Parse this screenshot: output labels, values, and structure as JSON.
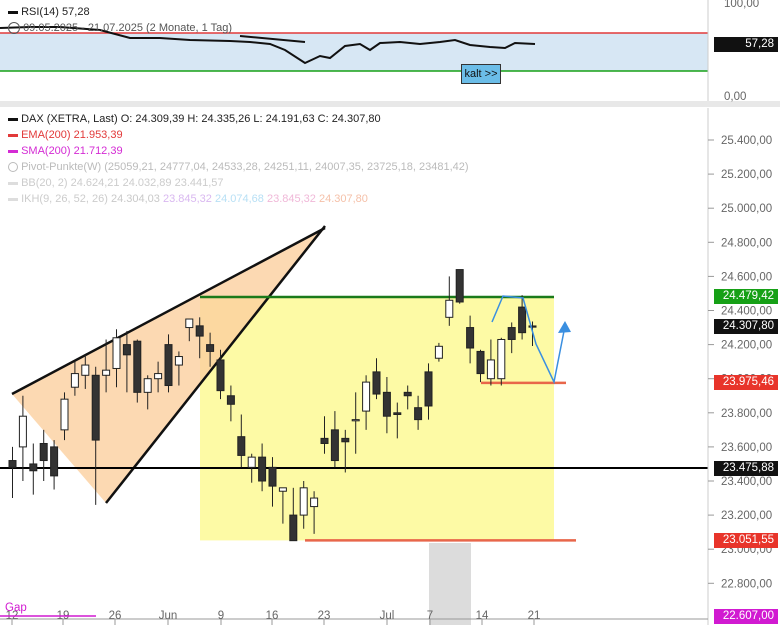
{
  "rsi_panel": {
    "label": "RSI(14)",
    "value_label": "57,28",
    "period": "09.05.2025 - 21.07.2025",
    "span": "(2 Monate, 1 Tag)",
    "y_ticks": [
      "100,00",
      "0,00"
    ],
    "current_tag": "57,28",
    "button_label": "kalt >>"
  },
  "legend": {
    "main": "DAX (XETRA, Last)",
    "ohlc": "O: 24.309,39   H: 24.335,26   L: 24.191,63   C: 24.307,80",
    "ema_label": "EMA(200)",
    "ema_value": "21.953,39",
    "sma_label": "SMA(200)",
    "sma_value": "21.712,39",
    "pivot_label": "Pivot-Punkte(W)",
    "pivot_values": "(25059,21,   24777,04,   24533,28,   24251,11,   24007,35,   23725,18,   23481,42)",
    "bb_label": "BB(20, 2)",
    "bb_values": "24.624,21   24.032,89   23.441,57",
    "ikh_label": "IKH(9, 26, 52, 26)",
    "ikh_values": [
      "24.304,03",
      "23.845,32",
      "24.074,68",
      "23.845,32",
      "24.307,80"
    ]
  },
  "colors": {
    "up": "#ffffff",
    "down": "#333333",
    "wedge": "#fbcf9f",
    "box": "#fdfaa0",
    "resistance": "#1a7a1a",
    "support": "#e8664a",
    "level": "#000000",
    "projection": "#3a8fe0",
    "ema": "#e23a3a",
    "sma": "#d42bd4",
    "tag_green": "#16a016",
    "tag_black": "#111111",
    "tag_red": "#e8342a",
    "tag_magenta": "#d11ad1",
    "rsi_fill": "#d7e7f4"
  },
  "price_axis_labels": [
    "25.400,00",
    "25.200,00",
    "25.000,00",
    "24.800,00",
    "24.600,00",
    "24.400,00",
    "24.200,00",
    "24.000,00",
    "23.800,00",
    "23.600,00",
    "23.400,00",
    "23.200,00",
    "23.000,00",
    "22.800,00"
  ],
  "x_axis_labels": [
    "12",
    "19",
    "26",
    "Jun",
    "9",
    "16",
    "23",
    "Jul",
    "7",
    "14",
    "21"
  ],
  "gap_label": "Gap",
  "price_tags": [
    {
      "value": "24.479,42",
      "price": 24479.42,
      "color": "tag_green"
    },
    {
      "value": "24.307,80",
      "price": 24307.8,
      "color": "tag_black"
    },
    {
      "value": "23.975,46",
      "price": 23975.46,
      "color": "tag_red"
    },
    {
      "value": "23.475,88",
      "price": 23475.88,
      "color": "tag_black"
    },
    {
      "value": "23.051,55",
      "price": 23051.55,
      "color": "tag_red"
    },
    {
      "value": "22.607,00",
      "price": 22607,
      "color": "tag_magenta"
    }
  ],
  "chart_data": {
    "type": "candlestick",
    "title": "DAX (XETRA, Last)",
    "period": "09.05.2025 - 21.07.2025",
    "ylim": [
      22607,
      25450
    ],
    "y_ticks": [
      25400,
      25200,
      25000,
      24800,
      24600,
      24400,
      24200,
      24000,
      23800,
      23600,
      23400,
      23200,
      23000,
      22800
    ],
    "levels": {
      "resistance": 24479.42,
      "support_upper": 23975.46,
      "horizontal": 23475.88,
      "support_lower": 23051.55
    },
    "candles": [
      {
        "o": 23520,
        "h": 23600,
        "l": 23300,
        "c": 23480
      },
      {
        "o": 23600,
        "h": 23900,
        "l": 23400,
        "c": 23780
      },
      {
        "o": 23500,
        "h": 23620,
        "l": 23320,
        "c": 23460
      },
      {
        "o": 23620,
        "h": 23700,
        "l": 23400,
        "c": 23520
      },
      {
        "o": 23600,
        "h": 23640,
        "l": 23350,
        "c": 23430
      },
      {
        "o": 23700,
        "h": 23920,
        "l": 23640,
        "c": 23880
      },
      {
        "o": 23950,
        "h": 24100,
        "l": 23900,
        "c": 24030
      },
      {
        "o": 24020,
        "h": 24140,
        "l": 23940,
        "c": 24080
      },
      {
        "o": 24020,
        "h": 24070,
        "l": 23260,
        "c": 23640
      },
      {
        "o": 24020,
        "h": 24230,
        "l": 23920,
        "c": 24050
      },
      {
        "o": 24060,
        "h": 24290,
        "l": 23950,
        "c": 24240
      },
      {
        "o": 24200,
        "h": 24280,
        "l": 23920,
        "c": 24140
      },
      {
        "o": 24220,
        "h": 24230,
        "l": 23860,
        "c": 23920
      },
      {
        "o": 23920,
        "h": 24020,
        "l": 23820,
        "c": 24000
      },
      {
        "o": 24000,
        "h": 24100,
        "l": 23920,
        "c": 24030
      },
      {
        "o": 24200,
        "h": 24260,
        "l": 23920,
        "c": 23960
      },
      {
        "o": 24080,
        "h": 24160,
        "l": 23960,
        "c": 24130
      },
      {
        "o": 24300,
        "h": 24350,
        "l": 24220,
        "c": 24350
      },
      {
        "o": 24310,
        "h": 24360,
        "l": 24120,
        "c": 24250
      },
      {
        "o": 24200,
        "h": 24270,
        "l": 24070,
        "c": 24160
      },
      {
        "o": 24110,
        "h": 24170,
        "l": 23880,
        "c": 23930
      },
      {
        "o": 23900,
        "h": 23960,
        "l": 23750,
        "c": 23850
      },
      {
        "o": 23660,
        "h": 23790,
        "l": 23480,
        "c": 23550
      },
      {
        "o": 23480,
        "h": 23560,
        "l": 23390,
        "c": 23540
      },
      {
        "o": 23540,
        "h": 23620,
        "l": 23340,
        "c": 23400
      },
      {
        "o": 23480,
        "h": 23540,
        "l": 23250,
        "c": 23370
      },
      {
        "o": 23340,
        "h": 23360,
        "l": 23150,
        "c": 23360
      },
      {
        "o": 23200,
        "h": 23360,
        "l": 23060,
        "c": 23050
      },
      {
        "o": 23200,
        "h": 23400,
        "l": 23120,
        "c": 23360
      },
      {
        "o": 23250,
        "h": 23340,
        "l": 23090,
        "c": 23300
      },
      {
        "o": 23650,
        "h": 23780,
        "l": 23560,
        "c": 23620
      },
      {
        "o": 23700,
        "h": 23810,
        "l": 23480,
        "c": 23520
      },
      {
        "o": 23650,
        "h": 23700,
        "l": 23450,
        "c": 23630
      },
      {
        "o": 23760,
        "h": 23920,
        "l": 23560,
        "c": 23760
      },
      {
        "o": 23810,
        "h": 24020,
        "l": 23700,
        "c": 23980
      },
      {
        "o": 24040,
        "h": 24120,
        "l": 23880,
        "c": 23910
      },
      {
        "o": 23920,
        "h": 24010,
        "l": 23680,
        "c": 23780
      },
      {
        "o": 23800,
        "h": 23860,
        "l": 23650,
        "c": 23790
      },
      {
        "o": 23920,
        "h": 23960,
        "l": 23820,
        "c": 23900
      },
      {
        "o": 23830,
        "h": 23900,
        "l": 23700,
        "c": 23760
      },
      {
        "o": 24040,
        "h": 24090,
        "l": 23760,
        "c": 23840
      },
      {
        "o": 24120,
        "h": 24210,
        "l": 24100,
        "c": 24190
      },
      {
        "o": 24360,
        "h": 24600,
        "l": 24310,
        "c": 24460
      },
      {
        "o": 24640,
        "h": 24640,
        "l": 24440,
        "c": 24450
      },
      {
        "o": 24300,
        "h": 24370,
        "l": 24090,
        "c": 24180
      },
      {
        "o": 24160,
        "h": 24170,
        "l": 23980,
        "c": 24030
      },
      {
        "o": 24000,
        "h": 24230,
        "l": 23960,
        "c": 24110
      },
      {
        "o": 24000,
        "h": 24240,
        "l": 23960,
        "c": 24230
      },
      {
        "o": 24300,
        "h": 24330,
        "l": 24150,
        "c": 24230
      },
      {
        "o": 24420,
        "h": 24490,
        "l": 24230,
        "c": 24270
      },
      {
        "o": 24309.39,
        "h": 24335.26,
        "l": 24191.63,
        "c": 24307.8
      }
    ]
  }
}
